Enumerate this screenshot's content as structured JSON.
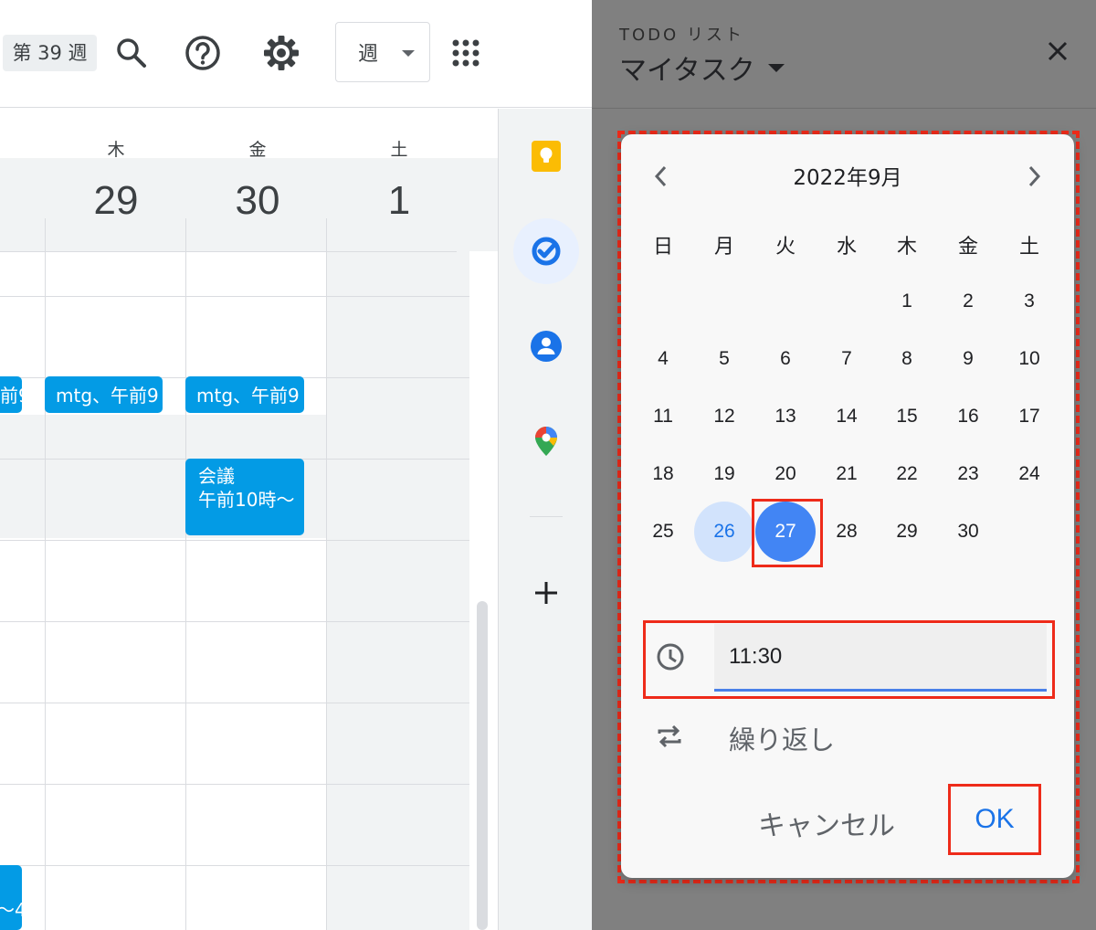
{
  "toolbar": {
    "week_badge": "第 39 週",
    "view_label": "週",
    "icons": [
      "search-icon",
      "help-icon",
      "settings-icon",
      "apps-grid-icon"
    ]
  },
  "calendar": {
    "columns": [
      {
        "dow": "木",
        "day": "29"
      },
      {
        "dow": "金",
        "day": "30"
      },
      {
        "dow": "土",
        "day": "1"
      }
    ],
    "events": {
      "left_partial": "前9",
      "thu_mtg": "mtg、午前9",
      "fri_mtg": "mtg、午前9",
      "fri_meeting_title": "会議",
      "fri_meeting_time": "午前10時〜",
      "bottom_partial": "〜4"
    }
  },
  "side_panel": {
    "icons": [
      "keep-icon",
      "tasks-icon",
      "contacts-icon",
      "maps-icon",
      "add-icon"
    ]
  },
  "tasks_panel": {
    "header": "TODO リスト",
    "list_name": "マイタスク"
  },
  "date_picker": {
    "month_title": "2022年9月",
    "weekdays": [
      "日",
      "月",
      "火",
      "水",
      "木",
      "金",
      "土"
    ],
    "weeks": [
      [
        "",
        "",
        "",
        "",
        "1",
        "2",
        "3"
      ],
      [
        "4",
        "5",
        "6",
        "7",
        "8",
        "9",
        "10"
      ],
      [
        "11",
        "12",
        "13",
        "14",
        "15",
        "16",
        "17"
      ],
      [
        "18",
        "19",
        "20",
        "21",
        "22",
        "23",
        "24"
      ],
      [
        "25",
        "26",
        "27",
        "28",
        "29",
        "30",
        ""
      ]
    ],
    "today": "26",
    "selected": "27",
    "time_value": "11:30",
    "repeat_label": "繰り返し",
    "cancel_label": "キャンセル",
    "ok_label": "OK",
    "colors": {
      "accent": "#4285f4",
      "today_bg": "#d2e3fc",
      "highlight_border": "#ee2b1a"
    }
  }
}
